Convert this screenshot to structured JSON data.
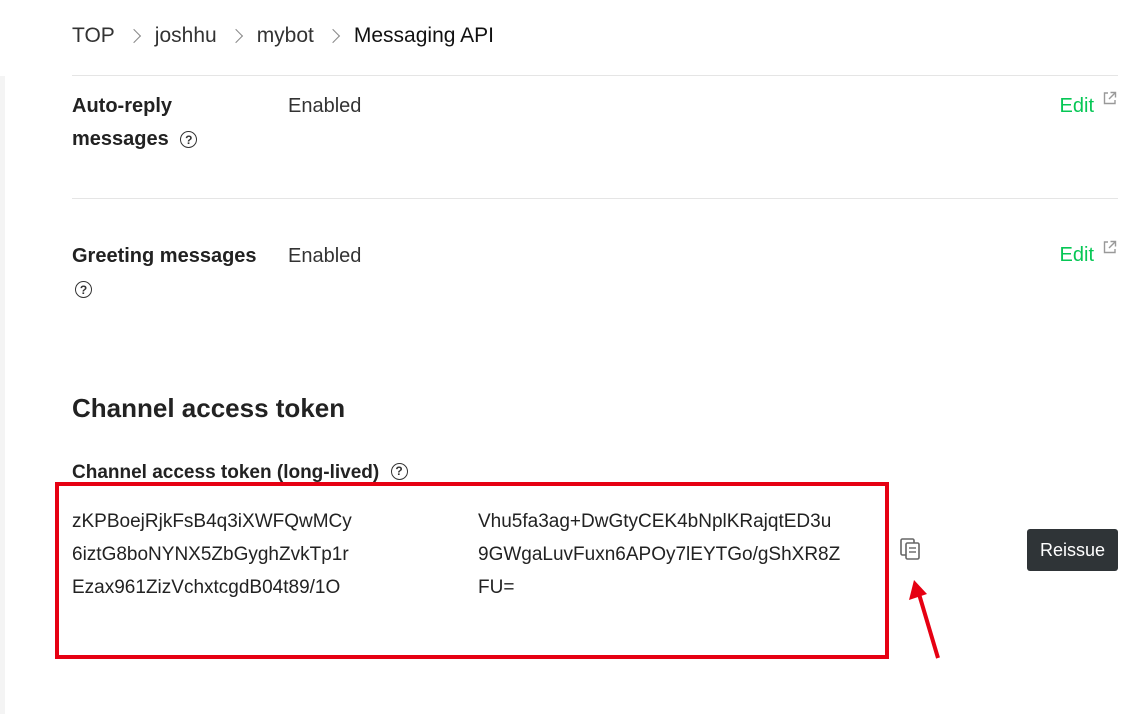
{
  "breadcrumb": {
    "items": [
      "TOP",
      "joshhu",
      "mybot",
      "Messaging API"
    ]
  },
  "settings": {
    "auto_reply": {
      "label": "Auto-reply messages",
      "value": "Enabled",
      "edit_label": "Edit"
    },
    "greeting": {
      "label": "Greeting messages",
      "value": "Enabled",
      "edit_label": "Edit"
    }
  },
  "channel_access_token": {
    "section_title": "Channel access token",
    "label": "Channel access token (long-lived)",
    "token_left_lines": [
      "zKPBoejRjkFsB4q3iXWFQwMCy",
      "6iztG8boNYNX5ZbGyghZvkTp1r",
      "Ezax961ZizVchxtcgdB04t89/1O"
    ],
    "token_right_lines": [
      "Vhu5fa3ag+DwGtyCEK4bNplKRajqtED3u",
      "9GWgaLuvFuxn6APOy7lEYTGo/gShXR8Z",
      "FU="
    ],
    "reissue_label": "Reissue"
  },
  "colors": {
    "accent_green": "#06c755",
    "highlight_red": "#e60012",
    "button_dark": "#2f3437"
  },
  "icons": {
    "help": "question-circle-icon",
    "external": "external-link-icon",
    "copy": "copy-icon"
  }
}
